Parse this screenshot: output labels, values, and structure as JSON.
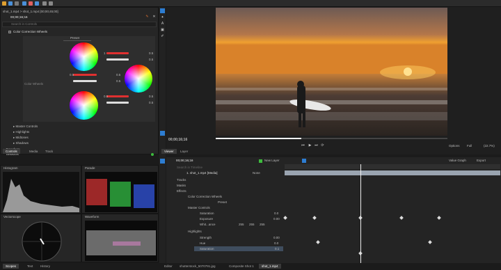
{
  "breadcrumb": "shot_1.mp4 > shot_1.mp4 [00;00;45;00]",
  "controls": {
    "timecode": "00;00;16;16",
    "search_placeholder": "Search in Controls",
    "effect_name": "Color Correction Wheels",
    "preset_label": "Preset",
    "color_wheels_label": "Color Wheels",
    "wheel_values": [
      "1",
      "0.5",
      "0.5",
      "0.5",
      "0.5",
      "0.5",
      "0.5",
      "0.5",
      "0.5",
      "0.5",
      "0.5"
    ],
    "sections": [
      "Master Controls",
      "Highlights",
      "Midtones",
      "Shadows"
    ],
    "transform": "Transform",
    "behaviors": "Behaviors"
  },
  "left_tabs": [
    "Controls",
    "Media",
    "Track"
  ],
  "histogram_title": "Histogram",
  "parade_title": "Parade",
  "vectorscope_title": "Vectorscope",
  "waveform_title": "Waveform",
  "bottom_tabs": [
    "Scopes",
    "Text",
    "History"
  ],
  "viewer": {
    "timecode": "00;00;16;16",
    "options": "Options",
    "full": "Full",
    "zoom": "(22.7%)",
    "tabs": [
      "Viewer",
      "Layer"
    ]
  },
  "timeline": {
    "timecode": "00;00;16;16",
    "new_layer": "New Layer",
    "value_graph": "Value Graph",
    "export": "Export",
    "search_placeholder": "Search in Timeline",
    "layer_name": "1. shot_1.mp4 [Media]",
    "blend_mode": "None",
    "rows": [
      "Tracks",
      "Masks",
      "Effects",
      "Color Correction Wheels",
      "Preset",
      "Master Controls",
      "Saturation",
      "Exposure",
      "Whit...ance",
      "Highlights",
      "Strength",
      "Hue",
      "Saturation"
    ],
    "values": {
      "saturation": "0.0",
      "exposure": "0.00",
      "wb": [
        "255",
        "255",
        "255"
      ],
      "strength": "0.00",
      "hue": "0.0",
      "hl_saturation": "0.1"
    },
    "bottom_tabs": [
      "Editor",
      "shutterstock_5070791.jpg",
      "Composite Shot 1",
      "shot_1.mp4"
    ]
  },
  "colors": {
    "accent": "#2d7dd2",
    "bg": "#1b1b1b",
    "panel": "#262626"
  }
}
